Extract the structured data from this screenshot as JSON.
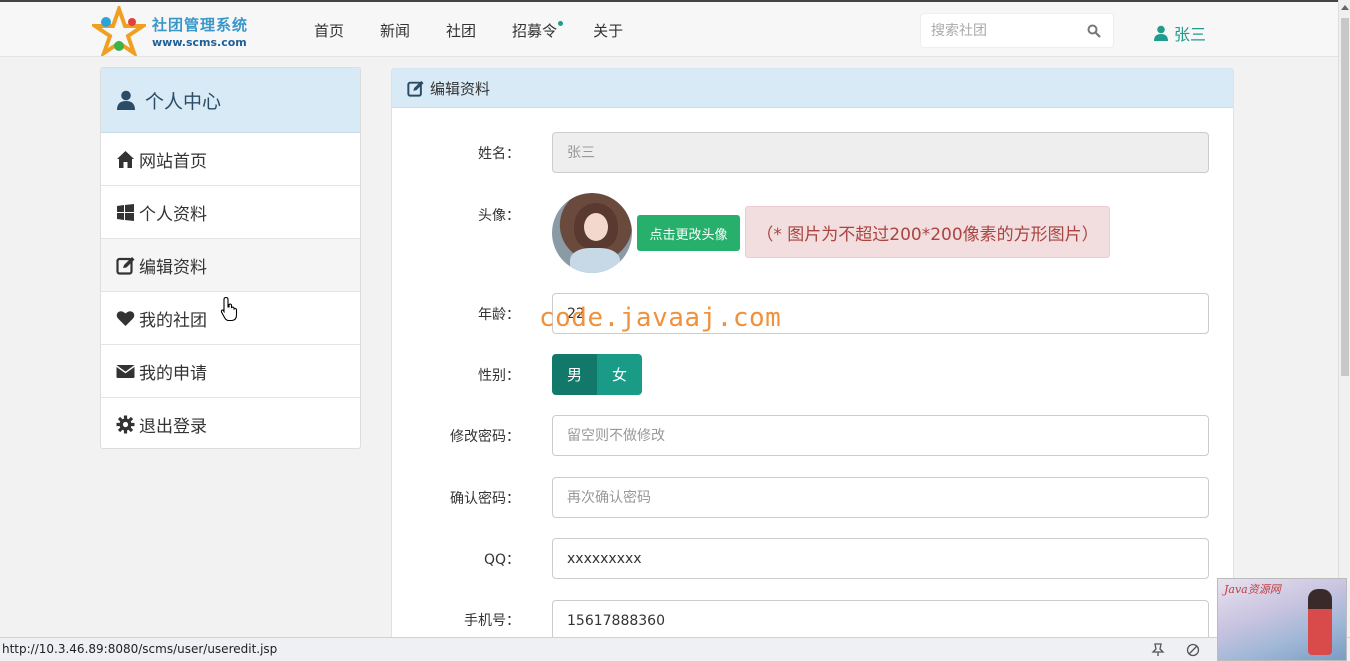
{
  "header": {
    "logo_title": "社团管理系统",
    "logo_url": "www.scms.com",
    "nav": [
      "首页",
      "新闻",
      "社团",
      "招募令",
      "关于"
    ],
    "search_placeholder": "搜索社团",
    "user_name": "张三"
  },
  "sidebar": {
    "title": "个人中心",
    "items": [
      {
        "label": "网站首页",
        "icon": "home-icon"
      },
      {
        "label": "个人资料",
        "icon": "windows-icon"
      },
      {
        "label": "编辑资料",
        "icon": "edit-icon"
      },
      {
        "label": "我的社团",
        "icon": "heart-icon"
      },
      {
        "label": "我的申请",
        "icon": "envelope-icon"
      },
      {
        "label": "退出登录",
        "icon": "gear-icon"
      }
    ]
  },
  "panel": {
    "title": "编辑资料",
    "fields": {
      "name_label": "姓名：",
      "name_value": "张三",
      "avatar_label": "头像：",
      "change_avatar_button": "点击更改头像",
      "avatar_tip": "（* 图片为不超过200*200像素的方形图片）",
      "age_label": "年龄：",
      "age_value": "22",
      "gender_label": "性别：",
      "gender_male": "男",
      "gender_female": "女",
      "password_label": "修改密码：",
      "password_placeholder": "留空则不做修改",
      "confirm_label": "确认密码：",
      "confirm_placeholder": "再次确认密码",
      "qq_label": "QQ：",
      "qq_value": "xxxxxxxxx",
      "phone_label": "手机号：",
      "phone_value": "15617888360"
    }
  },
  "watermark": "code.javaaj.com",
  "status": {
    "url": "http://10.3.46.89:8080/scms/user/useredit.jsp"
  },
  "corner_image_text": "Java资源网",
  "colors": {
    "accent": "#1f9c8d",
    "panel_header": "#d9eaf7",
    "button_green": "#26b06b",
    "gender_male": "#12786a",
    "gender_female": "#1a9b88",
    "tip_bg": "#f2dede",
    "tip_text": "#a94442"
  }
}
